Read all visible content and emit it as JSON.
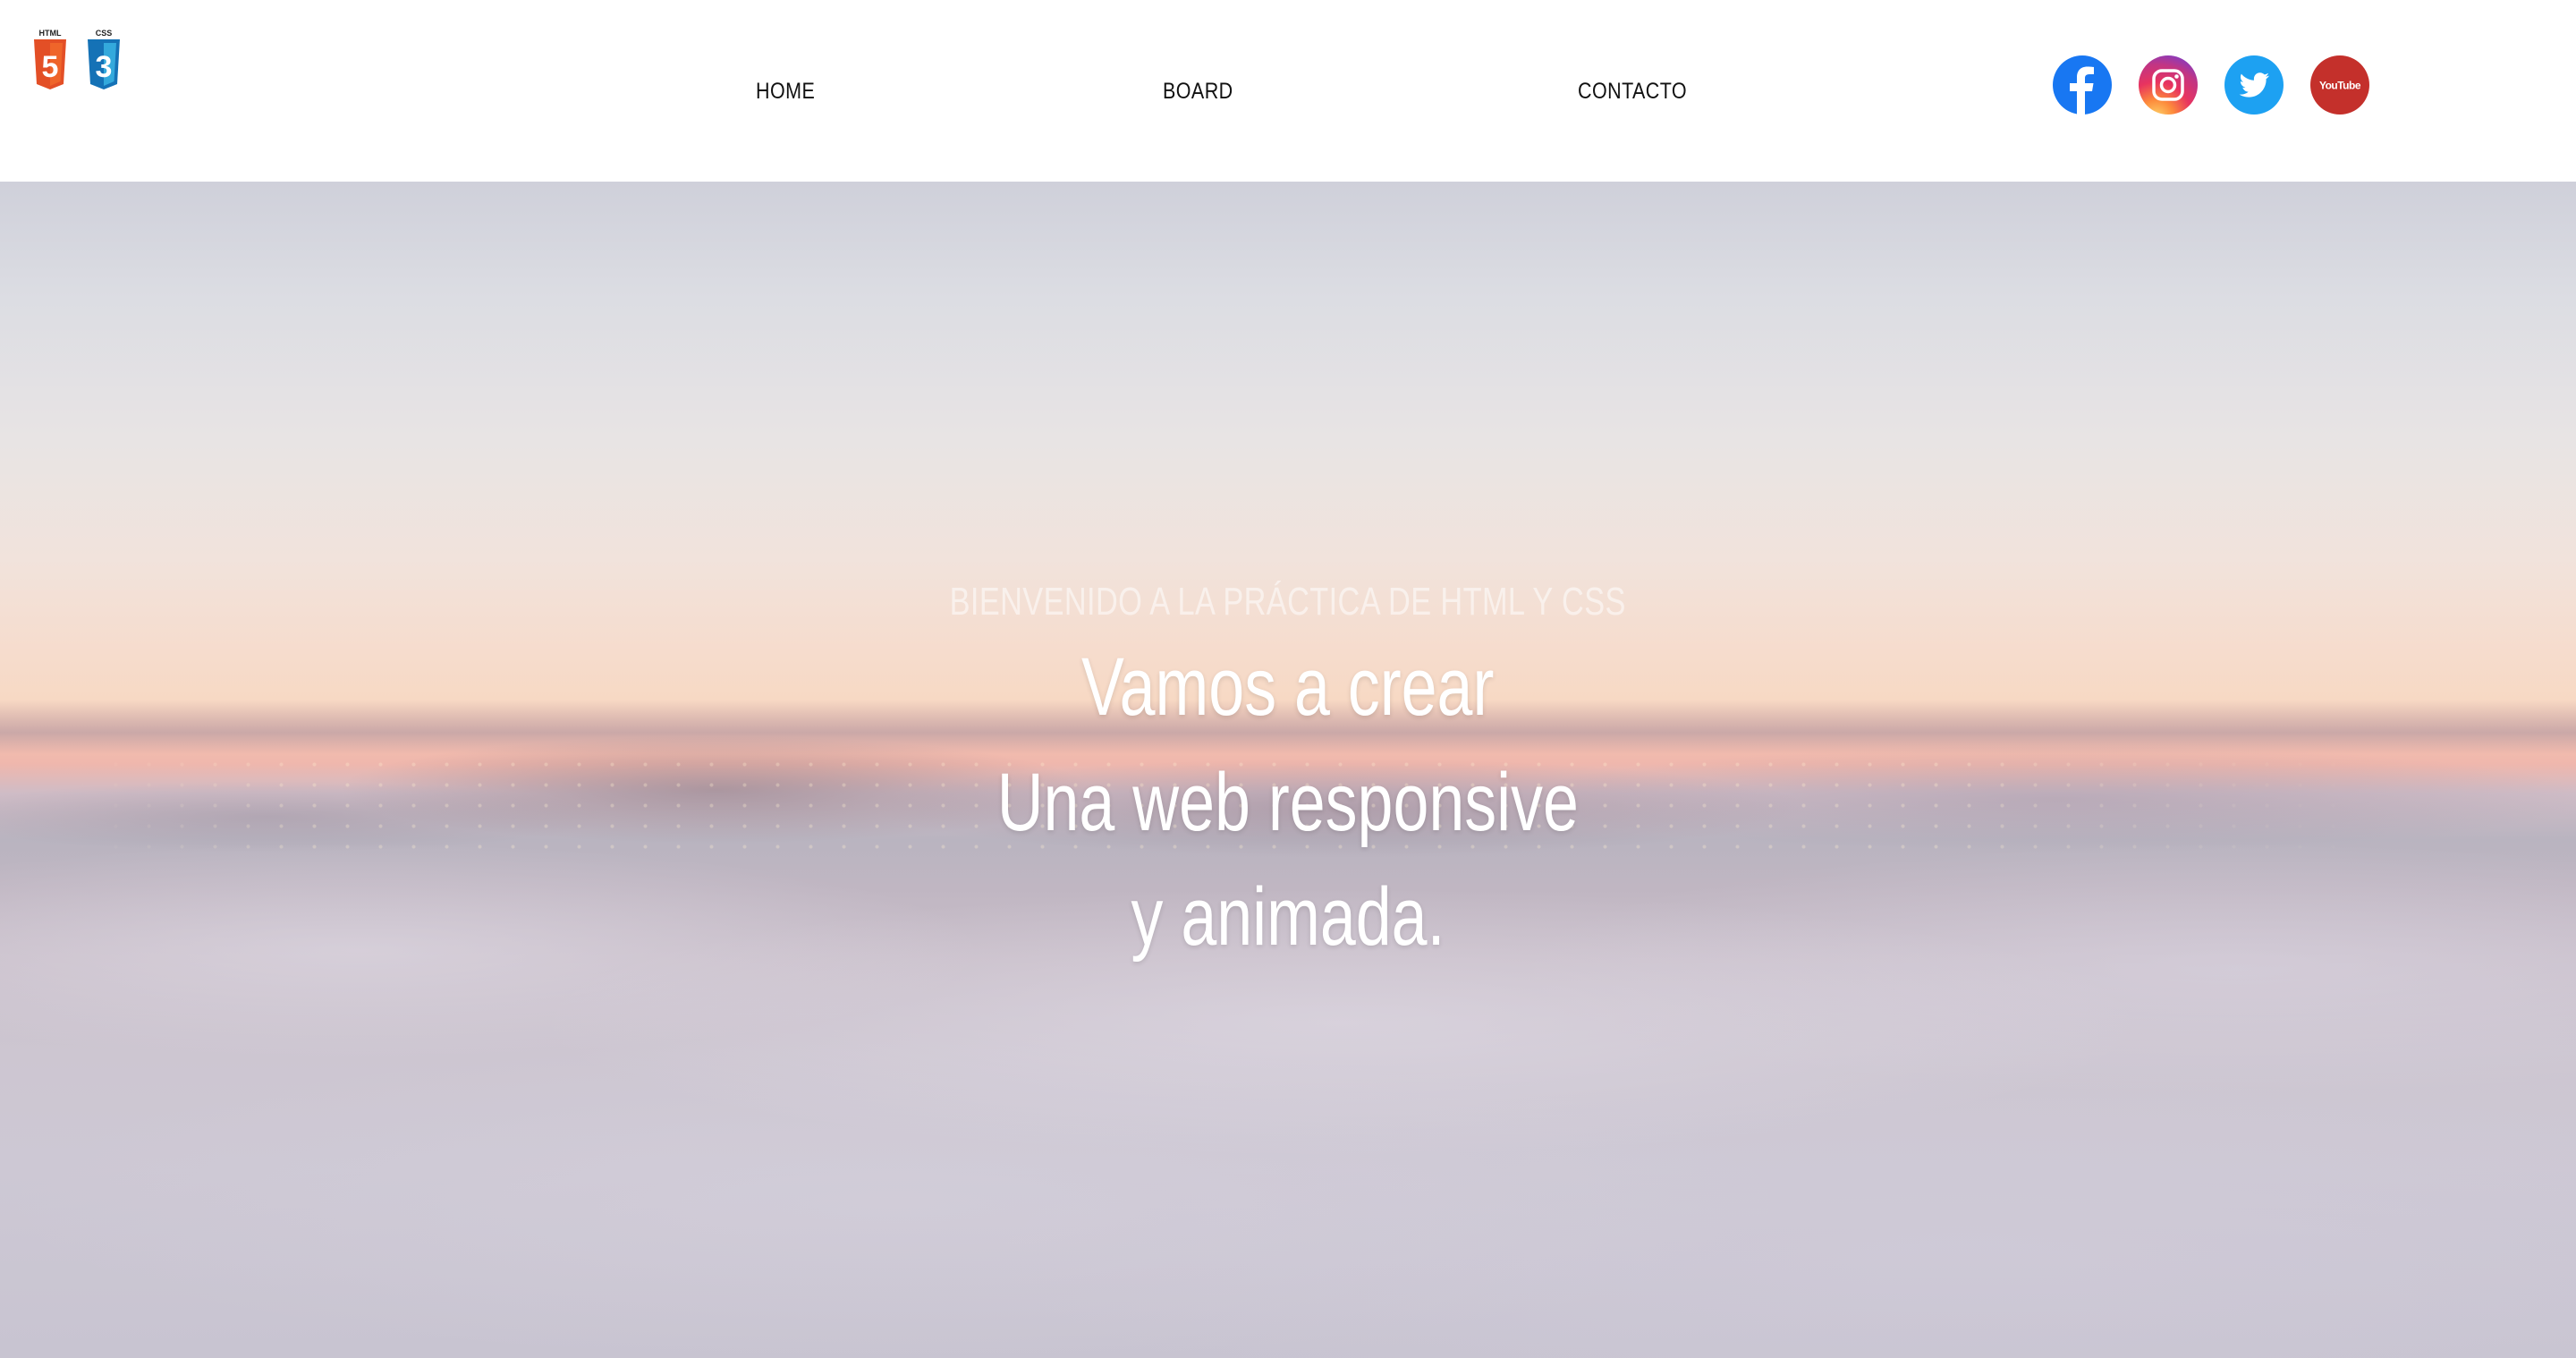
{
  "header": {
    "logo": {
      "html_label": "HTML",
      "html_number": "5",
      "css_label": "CSS",
      "css_number": "3"
    },
    "nav": [
      {
        "label": "HOME"
      },
      {
        "label": "BOARD"
      },
      {
        "label": "CONTACTO"
      }
    ],
    "social": [
      {
        "name": "facebook",
        "icon": "facebook-icon",
        "color": "#1877f2"
      },
      {
        "name": "instagram",
        "icon": "instagram-icon",
        "color": "#c13584"
      },
      {
        "name": "twitter",
        "icon": "twitter-icon",
        "color": "#1da1f2"
      },
      {
        "name": "youtube",
        "icon": "youtube-icon",
        "color": "#c4302b",
        "label": "YouTube"
      }
    ]
  },
  "hero": {
    "subtitle": "BIENVENIDO A LA PRÁCTICA DE HTML Y CSS",
    "lines": [
      "Vamos a crear",
      "Una web responsive",
      "y animada."
    ]
  }
}
